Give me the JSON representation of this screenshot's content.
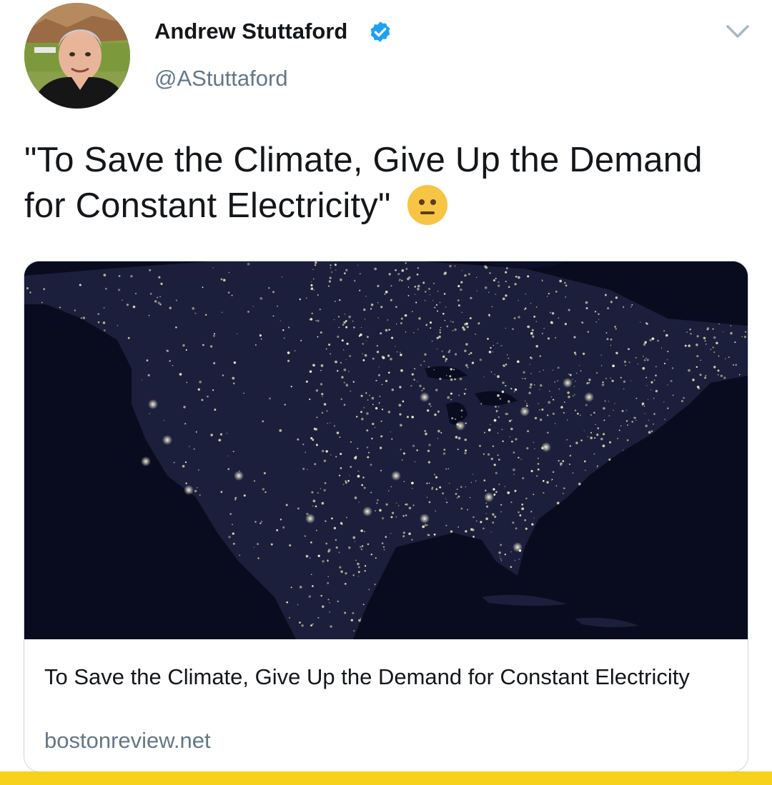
{
  "author": {
    "name": "Andrew Stuttaford",
    "handle": "@AStuttaford",
    "verified": true,
    "avatar_icon": "profile-photo"
  },
  "menu": {
    "icon": "chevron-down-icon"
  },
  "tweet": {
    "text": "\"To Save the Climate, Give Up the Demand for Constant Electricity\"",
    "emoji": "neutral-face-emoji"
  },
  "link_card": {
    "image_description_icon": "night-lights-map",
    "title": "To Save the Climate, Give Up the Demand for Constant Electricity",
    "domain": "bostonreview.net"
  },
  "colors": {
    "text_primary": "#14171a",
    "text_secondary": "#657786",
    "verified_blue": "#1da1f2",
    "card_border": "#ccd6dd",
    "bottom_bar": "#f7d21c",
    "map_background": "#0b0d22"
  }
}
